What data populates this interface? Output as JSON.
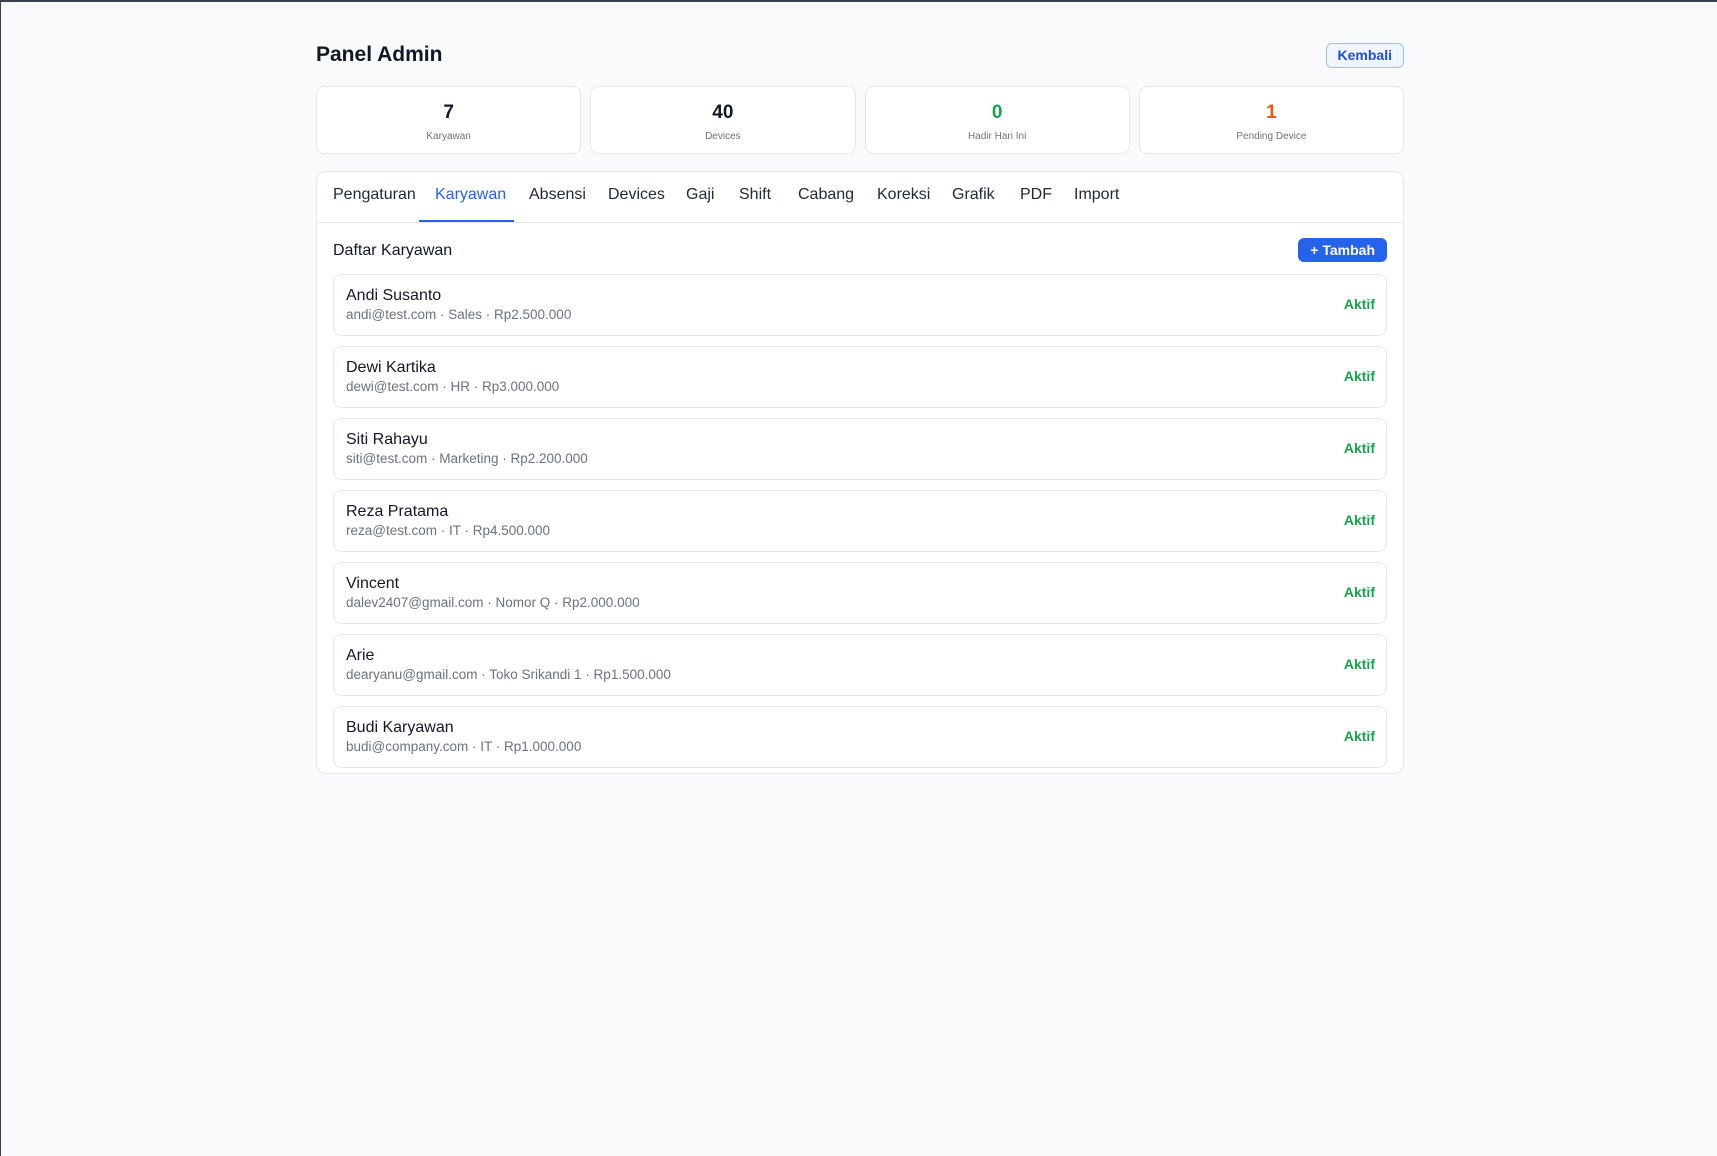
{
  "header": {
    "title": "Panel Admin",
    "back_label": "Kembali"
  },
  "stats": [
    {
      "value": "7",
      "label": "Karyawan",
      "color": "#111827"
    },
    {
      "value": "40",
      "label": "Devices",
      "color": "#111827"
    },
    {
      "value": "0",
      "label": "Hadir Hari Ini",
      "color": "#16a34a"
    },
    {
      "value": "1",
      "label": "Pending Device",
      "color": "#ea580c"
    }
  ],
  "tabs": [
    {
      "label": "Pengaturan"
    },
    {
      "label": "Karyawan",
      "active": true
    },
    {
      "label": "Absensi"
    },
    {
      "label": "Devices"
    },
    {
      "label": "Gaji"
    },
    {
      "label": "Shift"
    },
    {
      "label": "Cabang"
    },
    {
      "label": "Koreksi"
    },
    {
      "label": "Grafik"
    },
    {
      "label": "PDF"
    },
    {
      "label": "Import"
    }
  ],
  "employees_section": {
    "title": "Daftar Karyawan",
    "add_label": "+ Tambah"
  },
  "employees": [
    {
      "name": "Andi Susanto",
      "meta": "andi@test.com · Sales · Rp2.500.000",
      "status": "Aktif"
    },
    {
      "name": "Dewi Kartika",
      "meta": "dewi@test.com · HR · Rp3.000.000",
      "status": "Aktif"
    },
    {
      "name": "Siti Rahayu",
      "meta": "siti@test.com · Marketing · Rp2.200.000",
      "status": "Aktif"
    },
    {
      "name": "Reza Pratama",
      "meta": "reza@test.com · IT · Rp4.500.000",
      "status": "Aktif"
    },
    {
      "name": "Vincent",
      "meta": "dalev2407@gmail.com · Nomor Q · Rp2.000.000",
      "status": "Aktif"
    },
    {
      "name": "Arie",
      "meta": "dearyanu@gmail.com · Toko Srikandi 1 · Rp1.500.000",
      "status": "Aktif"
    },
    {
      "name": "Budi Karyawan",
      "meta": "budi@company.com · IT · Rp1.000.000",
      "status": "Aktif"
    }
  ],
  "colors": {
    "accent": "#2563eb",
    "status_active": "#16a34a",
    "pending": "#ea580c"
  }
}
